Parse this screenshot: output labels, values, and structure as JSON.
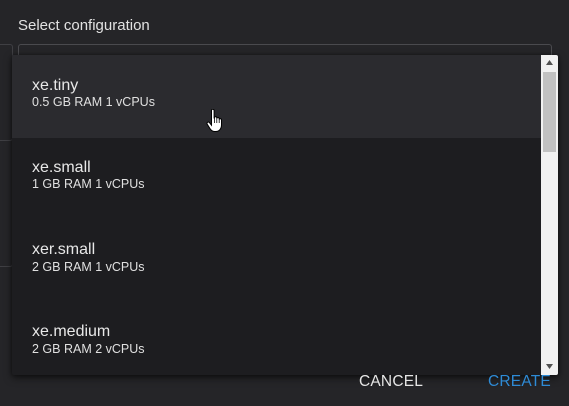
{
  "dialog": {
    "title": "Select configuration"
  },
  "dropdown": {
    "options": [
      {
        "name": "xe.tiny",
        "detail": "0.5 GB RAM 1 vCPUs",
        "highlighted": true
      },
      {
        "name": "xe.small",
        "detail": "1 GB RAM 1 vCPUs",
        "highlighted": false
      },
      {
        "name": "xer.small",
        "detail": "2 GB RAM 1 vCPUs",
        "highlighted": false
      },
      {
        "name": "xe.medium",
        "detail": "2 GB RAM 2 vCPUs",
        "highlighted": false
      }
    ]
  },
  "actions": {
    "cancel_label": "CANCEL",
    "create_label": "CREATE"
  },
  "colors": {
    "background": "#252528",
    "dropdown_background": "#1d1d20",
    "highlight": "#2b2b2f",
    "accent": "#2e8bd6"
  },
  "icons": {
    "cursor": "hand-pointer-icon",
    "scroll_up": "arrow-up-icon",
    "scroll_down": "arrow-down-icon"
  }
}
